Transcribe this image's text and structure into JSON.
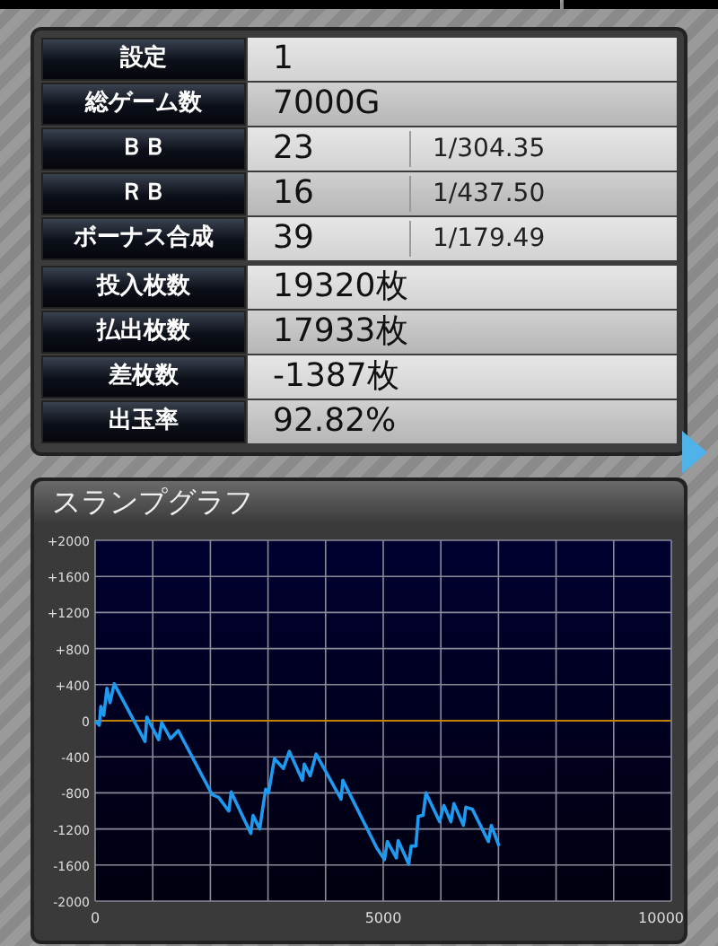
{
  "stats_groups": [
    [
      {
        "label": "設定",
        "value": "1"
      },
      {
        "label": "総ゲーム数",
        "value": "7000G"
      },
      {
        "label": "ＢＢ",
        "value": "23",
        "ratio": "1/304.35"
      },
      {
        "label": "ＲＢ",
        "value": "16",
        "ratio": "1/437.50"
      },
      {
        "label": "ボーナス合成",
        "value": "39",
        "ratio": "1/179.49"
      }
    ],
    [
      {
        "label": "投入枚数",
        "value": "19320枚"
      },
      {
        "label": "払出枚数",
        "value": "17933枚"
      },
      {
        "label": "差枚数",
        "value": "-1387枚"
      },
      {
        "label": "出玉率",
        "value": "92.82%"
      }
    ]
  ],
  "graph": {
    "title": "スランプグラフ",
    "chart_data": {
      "type": "line",
      "x": [
        0,
        72,
        100,
        150,
        206,
        258,
        330,
        866,
        897,
        1103,
        1155,
        1309,
        1443,
        2031,
        2144,
        2320,
        2361,
        2701,
        2742,
        2856,
        2907,
        2959,
        3010,
        3113,
        3268,
        3371,
        3598,
        3629,
        3732,
        3835,
        4268,
        4299,
        4887,
        5021,
        5072,
        5227,
        5258,
        5443,
        5485,
        5567,
        5608,
        5691,
        5742,
        5979,
        6052,
        6175,
        6227,
        6392,
        6433,
        6546,
        6825,
        6876,
        7010
      ],
      "grid": true,
      "ref_lines": [
        {
          "axis": "y",
          "value": 0,
          "color": "#c08000"
        }
      ],
      "series": [
        {
          "color": "#1e9bf0",
          "values": [
            0,
            -50,
            160,
            60,
            360,
            200,
            410,
            -230,
            40,
            -210,
            -20,
            -200,
            -110,
            -820,
            -850,
            -1000,
            -790,
            -1250,
            -1050,
            -1200,
            -980,
            -760,
            -800,
            -420,
            -530,
            -340,
            -660,
            -480,
            -610,
            -370,
            -870,
            -660,
            -1410,
            -1540,
            -1340,
            -1520,
            -1330,
            -1590,
            -1390,
            -1390,
            -1060,
            -1050,
            -800,
            -1120,
            -940,
            -1120,
            -920,
            -1160,
            -960,
            -980,
            -1340,
            -1160,
            -1390
          ]
        }
      ],
      "xlim": [
        0,
        10000
      ],
      "ylim": [
        -2000,
        2000
      ],
      "xticks": [
        0,
        5000,
        10000
      ],
      "yticks": [
        {
          "value": 2000,
          "label": "+2000"
        },
        {
          "value": 1600,
          "label": "+1600"
        },
        {
          "value": 1200,
          "label": "+1200"
        },
        {
          "value": 800,
          "label": "+800"
        },
        {
          "value": 400,
          "label": "+400"
        },
        0,
        -400,
        -800,
        -1200,
        -1600,
        -2000
      ]
    }
  }
}
